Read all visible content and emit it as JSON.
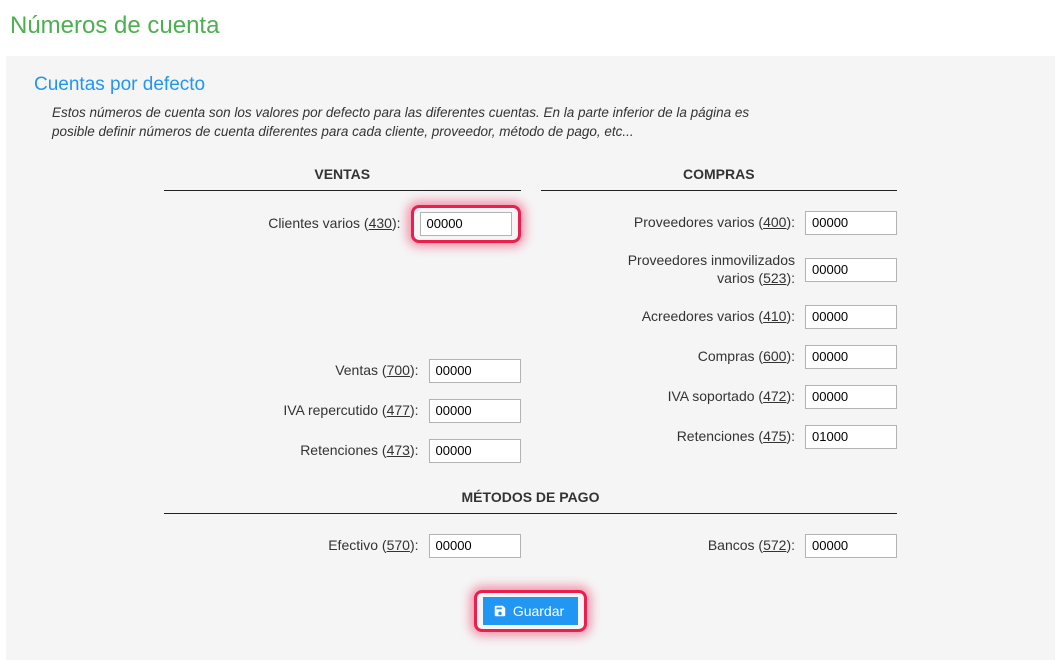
{
  "page_title": "Números de cuenta",
  "panel": {
    "title": "Cuentas por defecto",
    "description": "Estos números de cuenta son los valores por defecto para las diferentes cuentas. En la parte inferior de la página es posible definir números de cuenta diferentes para cada cliente, proveedor, método de pago, etc..."
  },
  "headers": {
    "ventas": "VENTAS",
    "compras": "COMPRAS",
    "pago": "MÉTODOS DE PAGO"
  },
  "ventas": {
    "clientes_varios": {
      "label_pre": "Clientes varios (",
      "code": "430",
      "label_post": "):",
      "value": "00000"
    },
    "ventas": {
      "label_pre": "Ventas (",
      "code": "700",
      "label_post": "):",
      "value": "00000"
    },
    "iva_repercutido": {
      "label_pre": "IVA repercutido (",
      "code": "477",
      "label_post": "):",
      "value": "00000"
    },
    "retenciones": {
      "label_pre": "Retenciones (",
      "code": "473",
      "label_post": "):",
      "value": "00000"
    }
  },
  "compras": {
    "proveedores_varios": {
      "label_pre": "Proveedores varios (",
      "code": "400",
      "label_post": "):",
      "value": "00000"
    },
    "proveedores_inmovilizados": {
      "label_line1": "Proveedores inmovilizados",
      "label_pre": "varios (",
      "code": "523",
      "label_post": "):",
      "value": "00000"
    },
    "acreedores_varios": {
      "label_pre": "Acreedores varios (",
      "code": "410",
      "label_post": "):",
      "value": "00000"
    },
    "compras": {
      "label_pre": "Compras (",
      "code": "600",
      "label_post": "):",
      "value": "00000"
    },
    "iva_soportado": {
      "label_pre": "IVA soportado (",
      "code": "472",
      "label_post": "):",
      "value": "00000"
    },
    "retenciones": {
      "label_pre": "Retenciones (",
      "code": "475",
      "label_post": "):",
      "value": "01000"
    }
  },
  "pago": {
    "efectivo": {
      "label_pre": "Efectivo (",
      "code": "570",
      "label_post": "):",
      "value": "00000"
    },
    "bancos": {
      "label_pre": "Bancos (",
      "code": "572",
      "label_post": "):",
      "value": "00000"
    }
  },
  "buttons": {
    "save": "Guardar"
  }
}
